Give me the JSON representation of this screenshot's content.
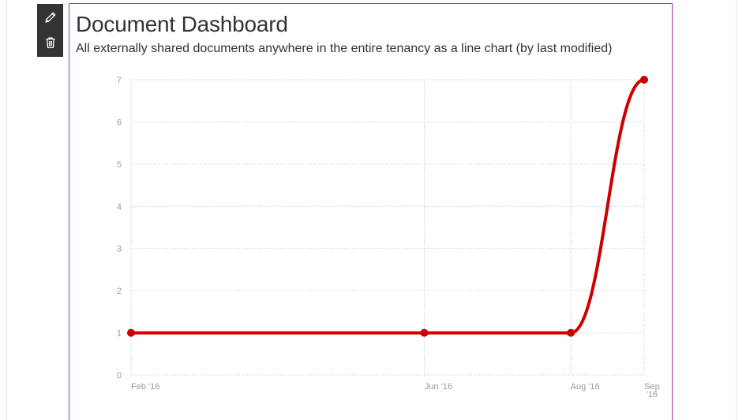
{
  "toolbar": {
    "edit_icon": "pencil-icon",
    "delete_icon": "trash-icon"
  },
  "webpart": {
    "title": "Document Dashboard",
    "subtitle": "All externally shared documents anywhere in the entire tenancy as a line chart (by last modified)",
    "border_color": "#a3358e"
  },
  "chart_data": {
    "type": "line",
    "x": [
      "Feb '16",
      "Jun '16",
      "Aug '16",
      "Sep '16"
    ],
    "series": [
      {
        "values": [
          1,
          1,
          1,
          7
        ],
        "color": "#cc0000"
      }
    ],
    "ylim": [
      0,
      7
    ],
    "yticks": [
      "0",
      "1",
      "2",
      "3",
      "4",
      "5",
      "6",
      "7"
    ],
    "grid": true
  }
}
